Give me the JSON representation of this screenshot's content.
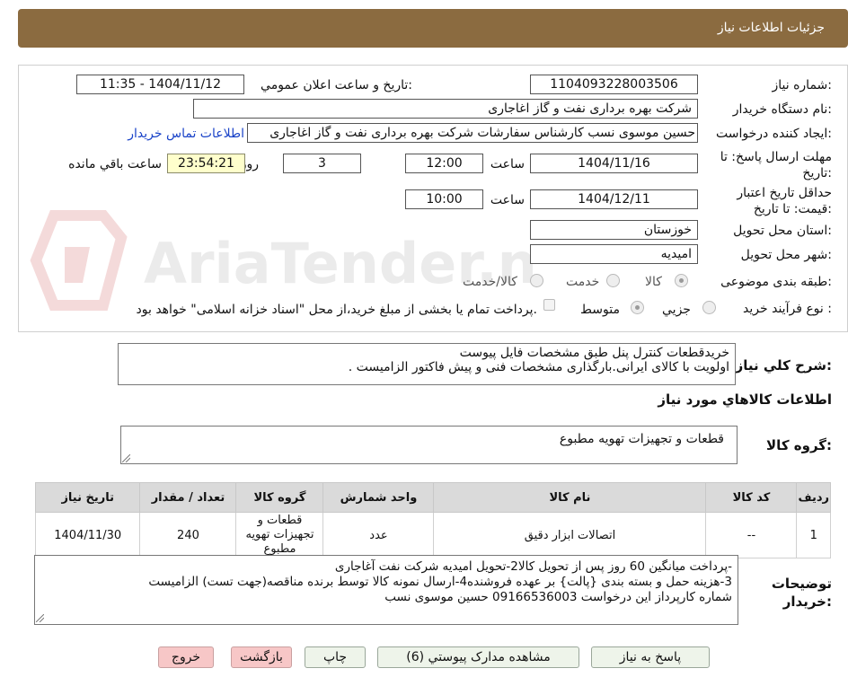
{
  "header": {
    "title": "جزئیات اطلاعات نیاز"
  },
  "form": {
    "need_number_label": "شماره نیاز:",
    "need_number": "1104093228003506",
    "announce_label": "تاریخ و ساعت اعلان عمومي:",
    "announce_value": "1404/11/12 - 11:35",
    "buyer_org_label": "نام دستگاه خریدار:",
    "buyer_org": "شرکت بهره برداری نفت و گاز اغاجاری",
    "requester_label": "ایجاد کننده درخواست:",
    "requester": "حسین موسوی نسب کارشناس سفارشات شرکت بهره برداری نفت و گاز اغاجاری",
    "contact_link": "اطلاعات تماس خریدار",
    "reply_deadline_label": "مهلت ارسال پاسخ: تا تاریخ:",
    "reply_date": "1404/11/16",
    "time_label": "ساعت",
    "reply_time": "12:00",
    "days_value": "3",
    "days_label": "روز و",
    "remaining_time": "23:54:21",
    "remaining_label": "ساعت باقي مانده",
    "validity_label": "حداقل تاریخ اعتبار قیمت: تا تاریخ:",
    "validity_date": "1404/12/11",
    "validity_time_label": "ساعت",
    "validity_time": "10:00",
    "province_label": "استان محل تحویل:",
    "province": "خوزستان",
    "city_label": "شهر محل تحویل:",
    "city": "امیدیه",
    "category_label": "طبقه بندی موضوعی:",
    "category_options": [
      "کالا",
      "خدمت",
      "کالا/خدمت"
    ],
    "process_label": "نوع فرآیند خرید :",
    "process_options": [
      "جزیي",
      "متوسط"
    ],
    "payment_note": "پرداخت تمام یا بخشی از مبلغ خرید،از محل \"اسناد خزانه اسلامی\" خواهد بود."
  },
  "summary": {
    "label": "شرح کلي نیاز:",
    "lines": [
      "خریدقطعات کنترل پنل طبق  مشخصات فایل پیوست",
      "اولویت با کالای ایرانی.بارگذاری مشخصات فنی و پیش فاکتور الزامیست ."
    ]
  },
  "goods": {
    "section_title": "اطلاعات کالاهاي مورد نیاز",
    "group_label": "گروه کالا:",
    "group_value": "قطعات و تجهیزات تهویه مطبوع",
    "columns": [
      "ردیف",
      "کد کالا",
      "نام کالا",
      "واحد شمارش",
      "گروه کالا",
      "تعداد / مقدار",
      "تاریخ نیاز"
    ],
    "rows": [
      [
        "1",
        "--",
        "اتصالات ابزار دقیق",
        "عدد",
        "قطعات و تجهیزات تهویه مطبوع",
        "240",
        "1404/11/30"
      ]
    ]
  },
  "notes": {
    "label": "توضیحات خریدار:",
    "lines": [
      "-پرداخت میانگین 60 روز پس از تحویل کالا2-تحویل امیدیه شرکت نفت آغاجاری",
      "3-هزینه حمل  و بسته بندی {پالت} بر عهده فروشنده4-ارسال نمونه کالا توسط برنده مناقصه(جهت تست) الزامیست",
      "شماره کارپرداز این درخواست 09166536003 حسین موسوی نسب"
    ]
  },
  "buttons": {
    "reply": "پاسخ به نیاز",
    "attachments": "مشاهده مدارک پیوستي (6)",
    "print": "چاپ",
    "back": "بازگشت",
    "exit": "خروج"
  },
  "watermark": {
    "logo_text": "AriaTender.neT"
  },
  "colors": {
    "header_bg": "#8b6b40",
    "link": "#1a43c8",
    "remaining_bg": "#ffffcc",
    "exit_btn": "#f7c7c7"
  }
}
